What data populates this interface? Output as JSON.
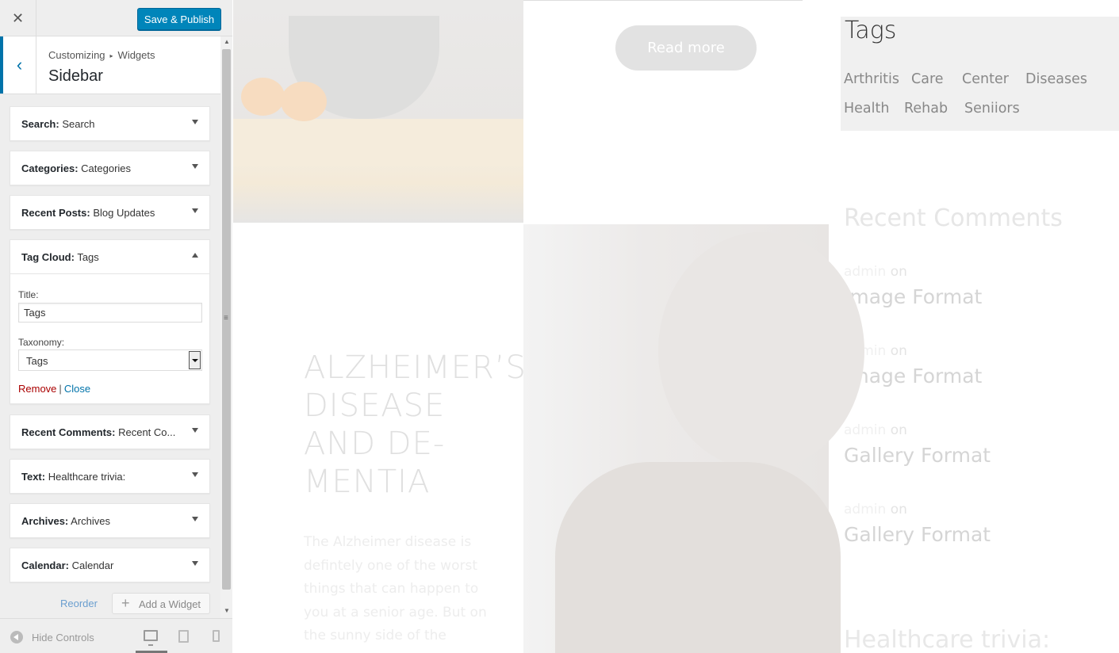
{
  "topbar": {
    "close_icon": "close-icon",
    "publish_label": "Save & Publish"
  },
  "section": {
    "crumb_parent": "Customizing",
    "crumb_child": "Widgets",
    "title": "Sidebar"
  },
  "widgets": [
    {
      "type": "Search:",
      "title": "Search"
    },
    {
      "type": "Categories:",
      "title": "Categories"
    },
    {
      "type": "Recent Posts:",
      "title": "Blog Updates"
    },
    {
      "type": "Tag Cloud:",
      "title": "Tags"
    },
    {
      "type": "Recent Comments:",
      "title": "Recent Co..."
    },
    {
      "type": "Text:",
      "title": "Healthcare trivia:"
    },
    {
      "type": "Archives:",
      "title": "Archives"
    },
    {
      "type": "Calendar:",
      "title": "Calendar"
    }
  ],
  "tagcloud_form": {
    "title_label": "Title:",
    "title_value": "Tags",
    "taxonomy_label": "Taxonomy:",
    "taxonomy_value": "Tags",
    "remove_label": "Remove",
    "separator": "|",
    "close_label": "Close"
  },
  "panel_actions": {
    "reorder_label": "Reorder",
    "add_widget_label": "Add a Widget"
  },
  "footer": {
    "hide_controls_label": "Hide Controls",
    "devices": [
      "desktop",
      "tablet",
      "mobile"
    ],
    "active_device": "desktop"
  },
  "preview": {
    "read_more": "Read more",
    "tags_title": "Tags",
    "tags": [
      "Arthritis",
      "Care",
      "Center",
      "Diseases",
      "Health",
      "Rehab",
      "Seniiors"
    ],
    "recent_comments_title": "Recent Comments",
    "comments": [
      {
        "author": "admin",
        "on": "on",
        "link": "Image Format"
      },
      {
        "author": "admin",
        "on": "on",
        "link": "Image Format"
      },
      {
        "author": "admin",
        "on": "on",
        "link": "Gallery Format"
      },
      {
        "author": "admin",
        "on": "on",
        "link": "Gallery Format"
      }
    ],
    "post_title": "ALZHEIMER’S DISEASE AND DE- MENTIA",
    "post_excerpt": "The Alzheimer disease is defintely one of the worst things that can happen to you at a senior age. But on the sunny side of the",
    "trivia_title": "Healthcare trivia:"
  },
  "colors": {
    "accent": "#0085ba",
    "link": "#0073aa",
    "remove": "#aa0000"
  }
}
